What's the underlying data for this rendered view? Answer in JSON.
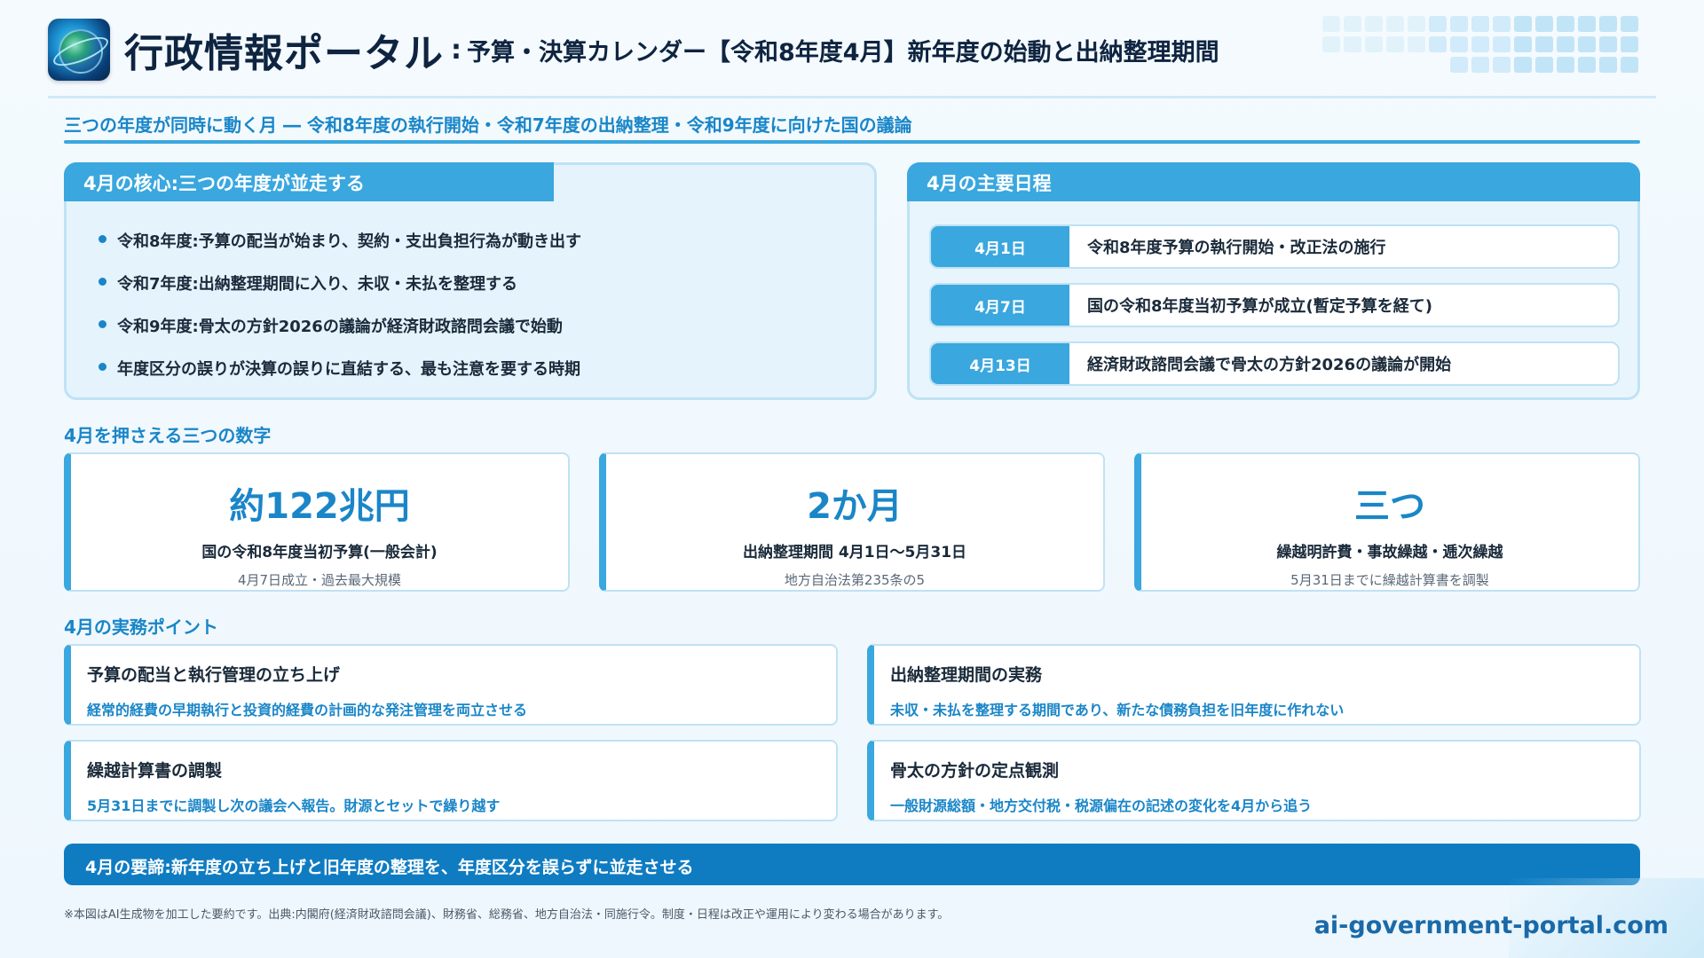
{
  "header": {
    "brand": "行政情報ポータル",
    "separator": ":",
    "title": "予算・決算カレンダー【令和8年度4月】新年度の始動と出納整理期間"
  },
  "subtitle": "三つの年度が同時に動く月 ― 令和8年度の執行開始・令和7年度の出納整理・令和9年度に向けた国の議論",
  "core": {
    "heading": "4月の核心:三つの年度が並走する",
    "bullets": [
      "令和8年度:予算の配当が始まり、契約・支出負担行為が動き出す",
      "令和7年度:出納整理期間に入り、未収・未払を整理する",
      "令和9年度:骨太の方針2026の議論が経済財政諮問会議で始動",
      "年度区分の誤りが決算の誤りに直結する、最も注意を要する時期"
    ]
  },
  "schedule": {
    "heading": "4月の主要日程",
    "items": [
      {
        "date": "4月1日",
        "event": "令和8年度予算の執行開始・改正法の施行"
      },
      {
        "date": "4月7日",
        "event": "国の令和8年度当初予算が成立(暫定予算を経て)"
      },
      {
        "date": "4月13日",
        "event": "経済財政諮問会議で骨太の方針2026の議論が開始"
      }
    ]
  },
  "numbers": {
    "label": "4月を押さえる三つの数字",
    "items": [
      {
        "value": "約122兆円",
        "caption": "国の令和8年度当初予算(一般会計)",
        "note": "4月7日成立・過去最大規模"
      },
      {
        "value": "2か月",
        "caption": "出納整理期間 4月1日〜5月31日",
        "note": "地方自治法第235条の5"
      },
      {
        "value": "三つ",
        "caption": "繰越明許費・事故繰越・逓次繰越",
        "note": "5月31日までに繰越計算書を調製"
      }
    ]
  },
  "points": {
    "label": "4月の実務ポイント",
    "items": [
      {
        "title": "予算の配当と執行管理の立ち上げ",
        "desc": "経常的経費の早期執行と投資的経費の計画的な発注管理を両立させる"
      },
      {
        "title": "出納整理期間の実務",
        "desc": "未収・未払を整理する期間であり、新たな債務負担を旧年度に作れない"
      },
      {
        "title": "繰越計算書の調製",
        "desc": "5月31日までに調製し次の議会へ報告。財源とセットで繰り越す"
      },
      {
        "title": "骨太の方針の定点観測",
        "desc": "一般財源総額・地方交付税・税源偏在の記述の変化を4月から追う"
      }
    ]
  },
  "summary": "4月の要諦:新年度の立ち上げと旧年度の整理を、年度区分を誤らずに並走させる",
  "footnote": "※本図はAI生成物を加工した要約です。出典:内閣府(経済財政諮問会議)、財務省、総務省、地方自治法・同施行令。制度・日程は改正や運用により変わる場合があります。",
  "url": "ai-government-portal.com",
  "colors": {
    "accent": "#3aa7de",
    "accent_dark": "#0f7cc2",
    "panel_bg": "#e4f3fc",
    "text": "#1a2a3a"
  },
  "icons": {
    "logo": "globe-logo-icon"
  }
}
